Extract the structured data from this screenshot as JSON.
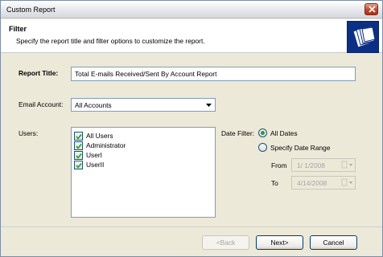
{
  "window": {
    "title": "Custom Report"
  },
  "header": {
    "title": "Filter",
    "subtitle": "Specify the report title and filter options to customize the report."
  },
  "form": {
    "report_title_label": "Report Title:",
    "report_title_value": "Total E-mails Received/Sent By Account Report",
    "email_account_label": "Email Account:",
    "email_account_value": "All Accounts",
    "users_label": "Users:",
    "users": [
      {
        "label": "All Users",
        "checked": true
      },
      {
        "label": "Administrator",
        "checked": true
      },
      {
        "label": "UserI",
        "checked": true
      },
      {
        "label": "UserII",
        "checked": true
      }
    ],
    "date_filter_label": "Date Filter:",
    "all_dates_label": "All Dates",
    "specify_range_label": "Specify Date Range",
    "from_label": "From",
    "from_value": "1/  1/2008",
    "to_label": "To",
    "to_value": "4/14/2008",
    "selected_date_option": "All Dates"
  },
  "buttons": {
    "back": "<Back",
    "next": "Next>",
    "cancel": "Cancel"
  },
  "colors": {
    "window_bg": "#ece9d8",
    "radio_selected": "#2b9a2b",
    "header_icon_bg": "#0b2f84"
  },
  "icons": {
    "header": "folders-icon",
    "checkbox": "checkmark-icon",
    "combo": "chevron-down-icon",
    "date": "calendar-dropdown-icon"
  }
}
